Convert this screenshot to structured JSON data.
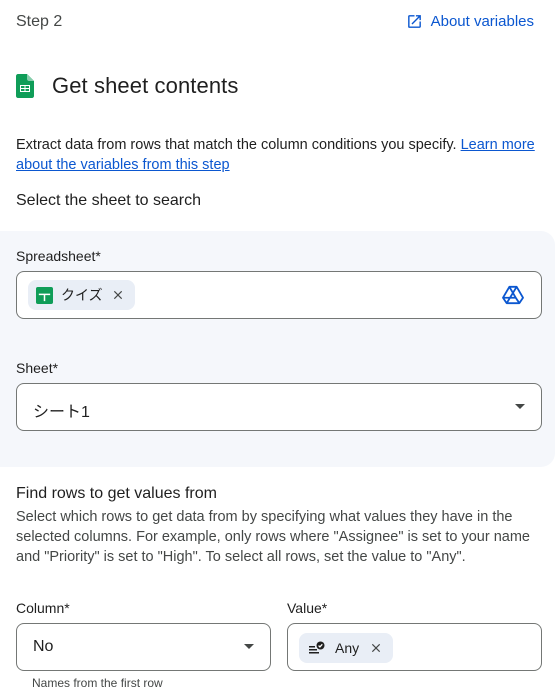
{
  "header": {
    "step": "Step 2",
    "about_link": "About variables"
  },
  "action": {
    "title": "Get sheet contents",
    "description_text": "Extract data from rows that match the column conditions you specify. ",
    "description_link": "Learn more about the variables from this step"
  },
  "sheet_section": {
    "heading": "Select the sheet to search",
    "spreadsheet_label": "Spreadsheet*",
    "spreadsheet_chip": "クイズ",
    "sheet_label": "Sheet*",
    "sheet_value": "シート1"
  },
  "rows_section": {
    "heading": "Find rows to get values from",
    "description": "Select which rows to get data from by specifying what values they have in the selected columns. For example, only rows where \"Assignee\" is set to your name and \"Priority\" is set to \"High\". To select all rows, set the value to \"Any\".",
    "column_label": "Column*",
    "column_value": "No",
    "value_label": "Value*",
    "value_chip": "Any",
    "column_hint": "Names from the first row"
  },
  "colors": {
    "link": "#0b57d0",
    "sheets_green": "#0f9d58",
    "panel_bg": "#f5f7fb",
    "chip_bg": "#e9eef6"
  },
  "icons": [
    "open-in-new-icon",
    "google-sheets-icon",
    "close-icon",
    "google-drive-icon",
    "dropdown-caret-icon",
    "any-value-icon"
  ]
}
